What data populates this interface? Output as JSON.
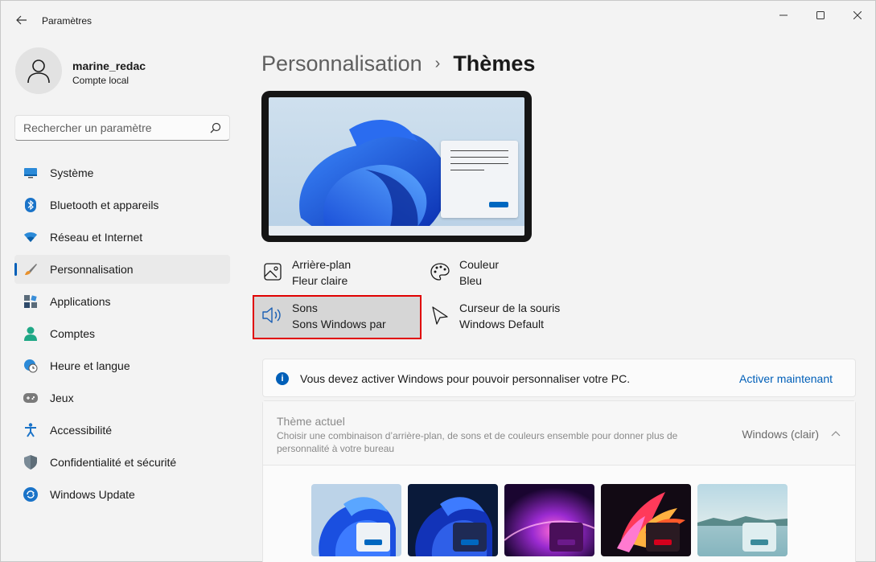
{
  "app": {
    "title": "Paramètres"
  },
  "user": {
    "name": "marine_redac",
    "account_type": "Compte local"
  },
  "search": {
    "placeholder": "Rechercher un paramètre"
  },
  "nav": {
    "items": [
      {
        "label": "Système",
        "icon": "monitor-icon"
      },
      {
        "label": "Bluetooth et appareils",
        "icon": "bluetooth-icon"
      },
      {
        "label": "Réseau et Internet",
        "icon": "wifi-icon"
      },
      {
        "label": "Personnalisation",
        "icon": "brush-icon",
        "active": true
      },
      {
        "label": "Applications",
        "icon": "apps-icon"
      },
      {
        "label": "Comptes",
        "icon": "person-icon"
      },
      {
        "label": "Heure et langue",
        "icon": "clock-globe-icon"
      },
      {
        "label": "Jeux",
        "icon": "gamepad-icon"
      },
      {
        "label": "Accessibilité",
        "icon": "accessibility-icon"
      },
      {
        "label": "Confidentialité et sécurité",
        "icon": "shield-icon"
      },
      {
        "label": "Windows Update",
        "icon": "update-icon"
      }
    ]
  },
  "breadcrumb": {
    "parent": "Personnalisation",
    "separator": "›",
    "current": "Thèmes"
  },
  "options": {
    "background": {
      "title": "Arrière-plan",
      "value": "Fleur claire",
      "icon": "image-icon"
    },
    "color": {
      "title": "Couleur",
      "value": "Bleu",
      "icon": "palette-icon"
    },
    "sounds": {
      "title": "Sons",
      "value": "Sons Windows par",
      "icon": "speaker-icon"
    },
    "cursor": {
      "title": "Curseur de la souris",
      "value": "Windows Default",
      "icon": "cursor-icon"
    }
  },
  "activation": {
    "message": "Vous devez activer Windows pour pouvoir personnaliser votre PC.",
    "link": "Activer maintenant",
    "icon": "info-icon"
  },
  "current_theme": {
    "title": "Thème actuel",
    "description": "Choisir une combinaison d’arrière-plan, de sons et de couleurs ensemble pour donner plus de personnalité à votre bureau",
    "value": "Windows (clair)",
    "thumbnails": [
      {
        "name": "windows-light",
        "accent": "#0067c0"
      },
      {
        "name": "windows-dark",
        "accent": "#0067c0"
      },
      {
        "name": "glow",
        "accent": "#6b1a8a"
      },
      {
        "name": "captured-motion",
        "accent": "#d4001c"
      },
      {
        "name": "flow",
        "accent": "#3a8a9a"
      }
    ]
  },
  "colors": {
    "accent": "#005fb8",
    "highlight_border": "#e00000"
  }
}
